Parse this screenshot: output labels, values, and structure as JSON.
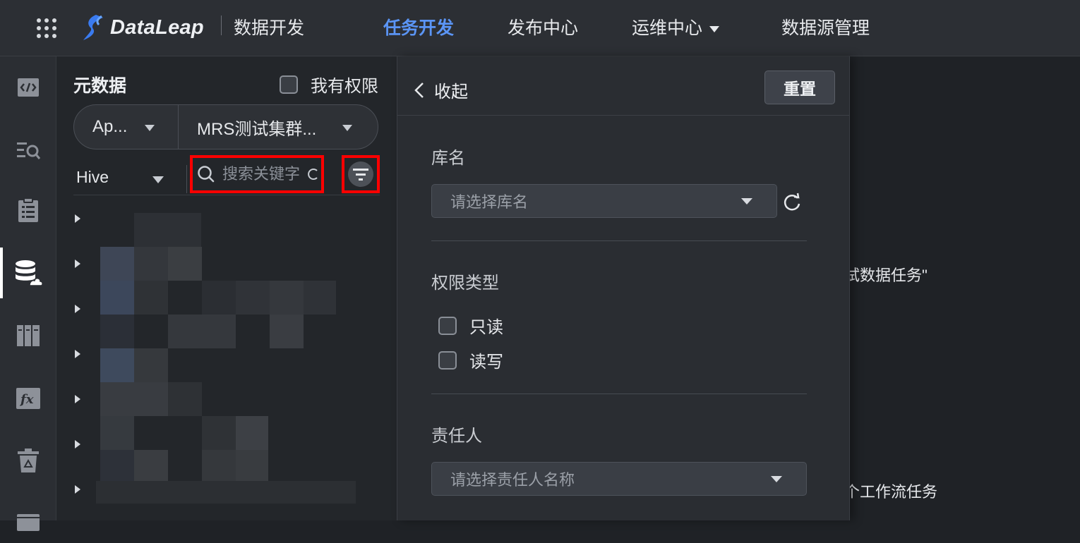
{
  "topbar": {
    "logo_text": "DataLeap",
    "product": "数据开发",
    "nav": [
      {
        "label": "任务开发",
        "active": true
      },
      {
        "label": "发布中心",
        "active": false
      },
      {
        "label": "运维中心",
        "active": false,
        "has_dropdown": true
      },
      {
        "label": "数据源管理",
        "active": false
      }
    ]
  },
  "rail": {
    "items": [
      {
        "icon": "code-icon"
      },
      {
        "icon": "search-list-icon"
      },
      {
        "icon": "clipboard-icon"
      },
      {
        "icon": "database-cloud-icon",
        "active": true
      },
      {
        "icon": "columns-icon"
      },
      {
        "icon": "function-icon"
      },
      {
        "icon": "trash-icon"
      },
      {
        "icon": "window-icon"
      }
    ]
  },
  "metadata_panel": {
    "title": "元数据",
    "my_permission_label": "我有权限",
    "project_select": "Ap...",
    "cluster_select": "MRS测试集群...",
    "type_select": "Hive",
    "search_placeholder": "搜索关键字",
    "tree_row_count": 7
  },
  "filter_panel": {
    "collapse_label": "收起",
    "reset_label": "重置",
    "db_label": "库名",
    "db_placeholder": "请选择库名",
    "perm_type_label": "权限类型",
    "perm_options": [
      "只读",
      "读写"
    ],
    "owner_label": "责任人",
    "owner_placeholder": "请选择责任人名称"
  },
  "background": {
    "text1": "试数据任务\"",
    "text2": "个工作流任务"
  },
  "colors": {
    "accent": "#5b95f5",
    "highlight_box": "#ff0000",
    "bg": "#1f2226"
  }
}
